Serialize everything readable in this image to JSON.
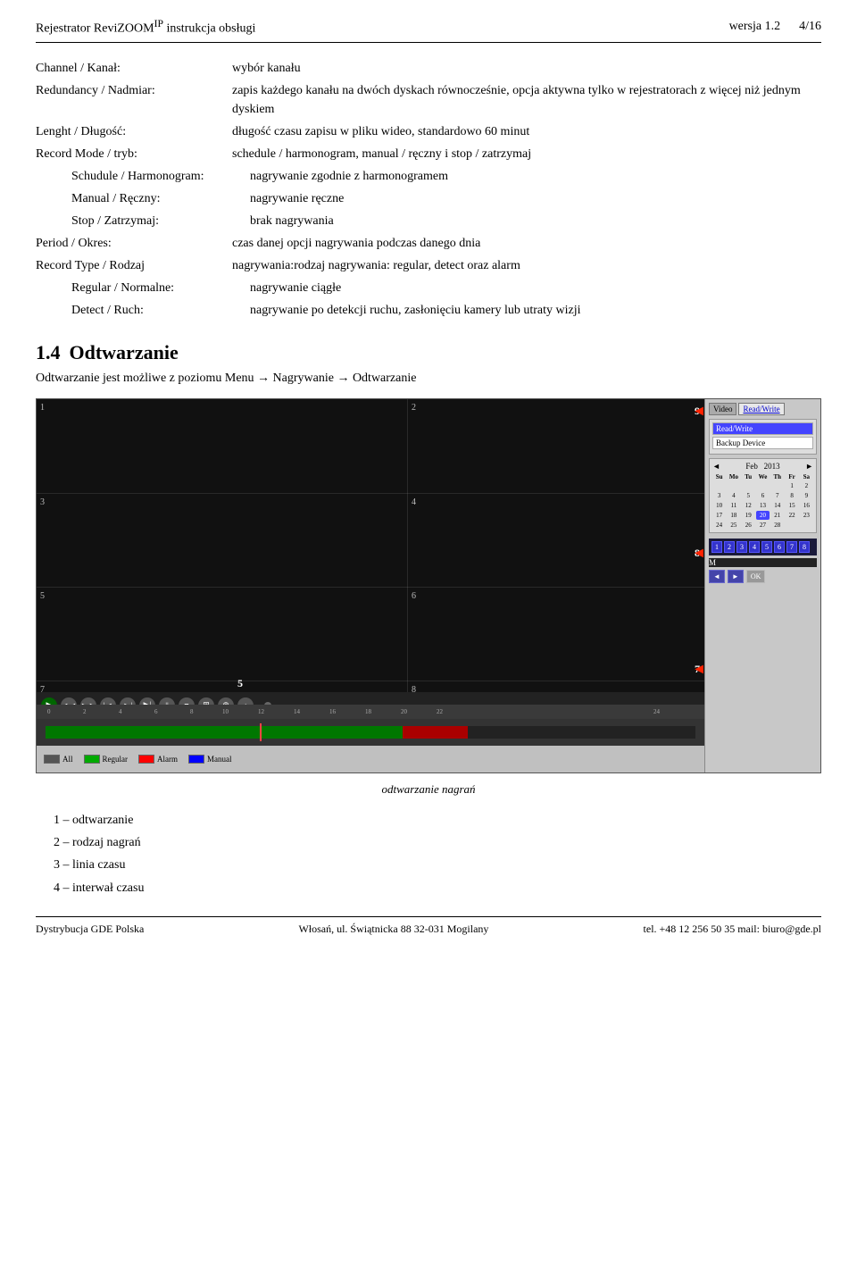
{
  "header": {
    "title": "Rejestrator ReviZOOM",
    "title_sup": "IP",
    "title_suffix": " instrukcja obsługi",
    "right": "wersja 1.2",
    "page": "4/16"
  },
  "definitions": [
    {
      "term": "Channel / Kanał:",
      "desc": "wybór kanału"
    },
    {
      "term": "Redundancy / Nadmiar:",
      "desc": "zapis każdego kanału na dwóch dyskach równocześnie, opcja aktywna tylko w rejestratorach z więcej niż jednym dyskiem"
    },
    {
      "term": "Lenght / Długość:",
      "desc": "długość czasu zapisu w pliku wideo, standardowo 60 minut"
    },
    {
      "term": "Record Mode / tryb:",
      "desc": "schedule / harmonogram, manual / ręczny i stop / zatrzymaj"
    }
  ],
  "indent_definitions": [
    {
      "term": "Schudule / Harmonogram:",
      "desc": "nagrywanie zgodnie z harmonogramem"
    },
    {
      "term": "Manual / Ręczny:",
      "desc": "nagrywanie ręczne"
    },
    {
      "term": "Stop / Zatrzymaj:",
      "desc": "brak nagrywania"
    }
  ],
  "period_row": {
    "term": "Period / Okres:",
    "desc": "czas danej opcji nagrywania podczas danego dnia"
  },
  "record_type_row": {
    "term": "Record Type / Rodzaj",
    "desc": "nagrywania:rodzaj nagrywania: regular, detect oraz alarm"
  },
  "indent_definitions2": [
    {
      "term": "Regular / Normalne:",
      "desc": "nagrywanie ciągłe"
    },
    {
      "term": "Detect / Ruch:",
      "desc": "nagrywanie po detekcji ruchu, zasłonięciu kamery lub utraty wizji"
    }
  ],
  "section": {
    "number": "1.4",
    "title": "Odtwarzanie",
    "subtitle": "Odtwarzanie jest możliwe z poziomu Menu → Nagrywanie → Odtwarzanie"
  },
  "screenshot": {
    "caption": "odtwarzanie nagrań",
    "panel": {
      "tabs": [
        "Video",
        "Read/Write"
      ],
      "options": [
        "Read/Write",
        "Backup Device"
      ],
      "calendar": {
        "month": "Feb",
        "year": "2013",
        "days_header": [
          "Su",
          "Mo",
          "Tu",
          "We",
          "Th",
          "Fr",
          "Sa"
        ],
        "weeks": [
          [
            "",
            "",
            "",
            "",
            "",
            "1",
            "2"
          ],
          [
            "3",
            "4",
            "5",
            "6",
            "7",
            "8",
            "9"
          ],
          [
            "10",
            "11",
            "12",
            "13",
            "14",
            "15",
            "16"
          ],
          [
            "17",
            "18",
            "19",
            "20",
            "21",
            "22",
            "23"
          ],
          [
            "24",
            "25",
            "26",
            "27",
            "28",
            "",
            ""
          ]
        ],
        "today": "20"
      }
    },
    "markers": {
      "nine": "9",
      "eight": "8",
      "seven": "7",
      "six": "6",
      "five": "5",
      "four": "4",
      "three": "3",
      "two": "2",
      "one": "1"
    },
    "legend_items": [
      "All",
      "Regular",
      "Alarm",
      "Manual"
    ],
    "legend_colors": [
      "#555",
      "#00aa00",
      "#ff0000",
      "#0000ff"
    ]
  },
  "list_items": [
    "1 – odtwarzanie",
    "2 – rodzaj nagrań",
    "3 – linia czasu",
    "4 – interwał czasu"
  ],
  "footer": {
    "left": "Dystrybucja GDE Polska",
    "middle": "Włosań, ul. Świątnicka 88 32-031 Mogilany",
    "right": "tel. +48 12 256 50 35 mail: biuro@gde.pl"
  }
}
